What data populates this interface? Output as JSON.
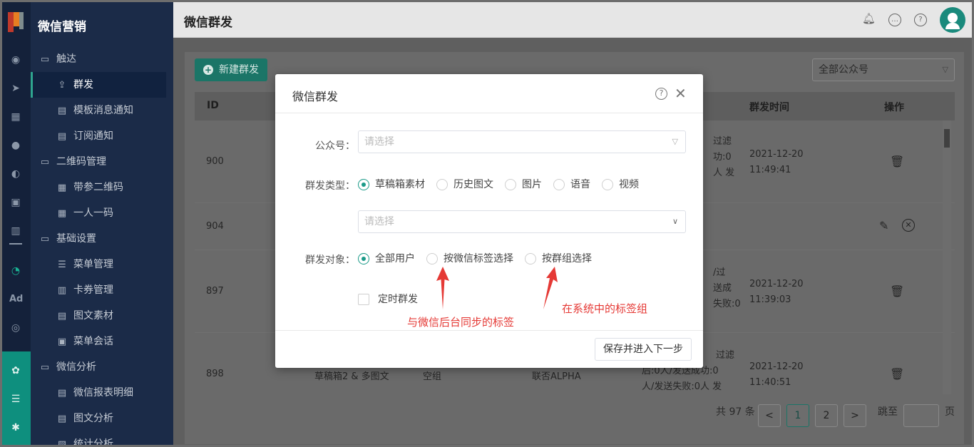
{
  "app": {
    "brand": "微信营销",
    "page_title": "微信群发"
  },
  "sidebar": {
    "items": [
      {
        "label": "触达",
        "type": "group",
        "icon": "folder-icon"
      },
      {
        "label": "群发",
        "type": "sub",
        "icon": "send-icon",
        "active": true
      },
      {
        "label": "模板消息通知",
        "type": "sub",
        "icon": "template-icon"
      },
      {
        "label": "订阅通知",
        "type": "sub",
        "icon": "subscribe-icon"
      },
      {
        "label": "二维码管理",
        "type": "group",
        "icon": "folder-icon"
      },
      {
        "label": "带参二维码",
        "type": "sub",
        "icon": "qrcode-icon"
      },
      {
        "label": "一人一码",
        "type": "sub",
        "icon": "qrcode-icon"
      },
      {
        "label": "基础设置",
        "type": "group",
        "icon": "folder-icon"
      },
      {
        "label": "菜单管理",
        "type": "sub",
        "icon": "list-icon"
      },
      {
        "label": "卡券管理",
        "type": "sub",
        "icon": "coupon-icon"
      },
      {
        "label": "图文素材",
        "type": "sub",
        "icon": "document-icon"
      },
      {
        "label": "菜单会话",
        "type": "sub",
        "icon": "chat-icon"
      },
      {
        "label": "微信分析",
        "type": "group",
        "icon": "folder-icon"
      },
      {
        "label": "微信报表明细",
        "type": "sub",
        "icon": "document-icon"
      },
      {
        "label": "图文分析",
        "type": "sub",
        "icon": "document-icon"
      },
      {
        "label": "统计分析",
        "type": "sub",
        "icon": "chart-icon"
      }
    ],
    "rail_label": "Ad"
  },
  "toolbar": {
    "new_label": "新建群发",
    "account_select": "全部公众号"
  },
  "table": {
    "headers": {
      "id": "ID",
      "time": "群发时间",
      "ops": "操作"
    },
    "rows": [
      {
        "id": "900",
        "result": [
          "过滤",
          "功:0",
          "人 发"
        ],
        "time": [
          "2021-12-20",
          "11:49:41"
        ],
        "ops": "delete"
      },
      {
        "id": "904",
        "result": [],
        "time": [],
        "ops": "edit-cancel"
      },
      {
        "id": "897",
        "result": [
          "/过",
          "送成",
          "失败:0"
        ],
        "time": [
          "2021-12-20",
          "11:39:03"
        ],
        "ops": "delete"
      },
      {
        "id": "898",
        "material": "草稿箱2 & 多图文",
        "group": "空组",
        "account": "联否ALPHA",
        "result": [
          "过滤",
          "后:0人/发送成功:0",
          "人/发送失败:0人 发"
        ],
        "time": [
          "2021-12-20",
          "11:40:51"
        ],
        "ops": "delete"
      }
    ]
  },
  "pagination": {
    "total": "共 97 条",
    "pages": [
      "1",
      "2"
    ],
    "current": "1",
    "prev": "<",
    "next": ">",
    "jump_label": "跳至",
    "page_unit": "页"
  },
  "modal": {
    "title": "微信群发",
    "fields": {
      "account_label": "公众号：",
      "account_placeholder": "请选择",
      "type_label": "群发类型：",
      "types": [
        "草稿箱素材",
        "历史图文",
        "图片",
        "语音",
        "视频"
      ],
      "type_selected": "草稿箱素材",
      "material_placeholder": "请选择",
      "target_label": "群发对象：",
      "targets": [
        "全部用户",
        "按微信标签选择",
        "按群组选择"
      ],
      "target_selected": "全部用户",
      "scheduled_label": "定时群发"
    },
    "next_button": "保存并进入下一步"
  },
  "annotations": {
    "wechat_tags": "与微信后台同步的标签",
    "system_tags": "在系统中的标签组"
  },
  "colors": {
    "primary": "#1a9a88",
    "annotation": "#e53935",
    "sidebar": "#1b2b48"
  }
}
